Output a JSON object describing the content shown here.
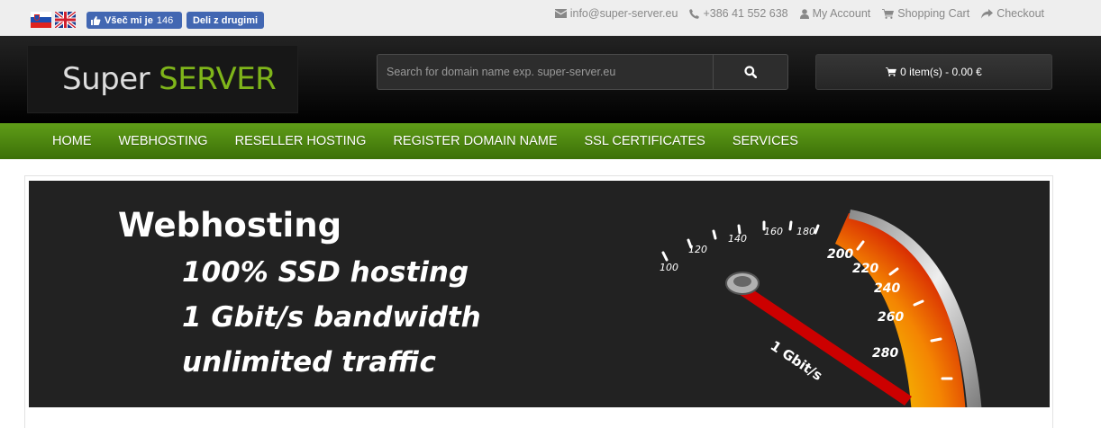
{
  "topbar": {
    "languages": [
      {
        "name": "slovenian-flag"
      },
      {
        "name": "english-flag"
      }
    ],
    "fb_like": {
      "label": "Všeč mi je",
      "count": "146"
    },
    "fb_share": {
      "label": "Deli z drugimi"
    },
    "links": [
      {
        "icon": "envelope-icon",
        "label": "info@super-server.eu"
      },
      {
        "icon": "phone-icon",
        "label": "+386 41 552 638"
      },
      {
        "icon": "user-icon",
        "label": "My Account"
      },
      {
        "icon": "cart-icon",
        "label": "Shopping Cart"
      },
      {
        "icon": "share-icon",
        "label": "Checkout"
      }
    ]
  },
  "header": {
    "logo": {
      "part1": "Super",
      "part2": "SERVER"
    },
    "search": {
      "placeholder": "Search for domain name exp. super-server.eu",
      "value": ""
    },
    "cart": {
      "label": "0 item(s) - 0.00 €"
    }
  },
  "nav": {
    "items": [
      "HOME",
      "WEBHOSTING",
      "RESELLER HOSTING",
      "REGISTER DOMAIN NAME",
      "SSL CERTIFICATES",
      "SERVICES"
    ]
  },
  "banner": {
    "title": "Webhosting",
    "lines": [
      "100% SSD hosting",
      "1 Gbit/s bandwidth",
      "unlimited traffic"
    ],
    "gauge": {
      "ticks": [
        "100",
        "120",
        "140",
        "160",
        "180",
        "200",
        "220",
        "240",
        "260",
        "280"
      ],
      "needle_label": "1 Gbit/s"
    }
  },
  "colors": {
    "accent_green": "#7fb51a",
    "nav_green": "#4f8a10",
    "facebook_blue": "#4267b2"
  }
}
